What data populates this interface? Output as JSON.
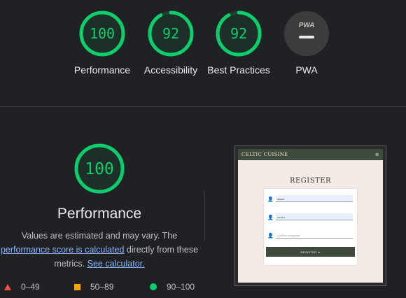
{
  "scores": [
    {
      "label": "Performance",
      "value": "100",
      "fraction": 1.0
    },
    {
      "label": "Accessibility",
      "value": "92",
      "fraction": 0.92
    },
    {
      "label": "Best Practices",
      "value": "92",
      "fraction": 0.92
    },
    {
      "label": "PWA",
      "value": "",
      "badge": "PWA"
    }
  ],
  "performance": {
    "value": "100",
    "fraction": 1.0,
    "title": "Performance",
    "desc_before": "Values are estimated and may vary. The ",
    "desc_link1": "performance score is calculated",
    "desc_middle": " directly from these metrics. ",
    "desc_link2": "See calculator."
  },
  "legend": [
    {
      "range": "0–49",
      "shape": "triangle",
      "color": "#ff4e42"
    },
    {
      "range": "50–89",
      "shape": "square",
      "color": "#ffa400"
    },
    {
      "range": "90–100",
      "shape": "circle",
      "color": "#0cce6b"
    }
  ],
  "screenshot": {
    "brand": "CELTIC CUISINE",
    "menu_icon": "≡",
    "heading": "REGISTER",
    "field1_value": "adam",
    "field2_value": "••••••••",
    "field3_placeholder": "Confirm password",
    "button": "REGISTER ➜"
  },
  "colors": {
    "pass": "#0cce6b",
    "average": "#ffa400",
    "fail": "#ff4e42",
    "background": "#202124"
  }
}
